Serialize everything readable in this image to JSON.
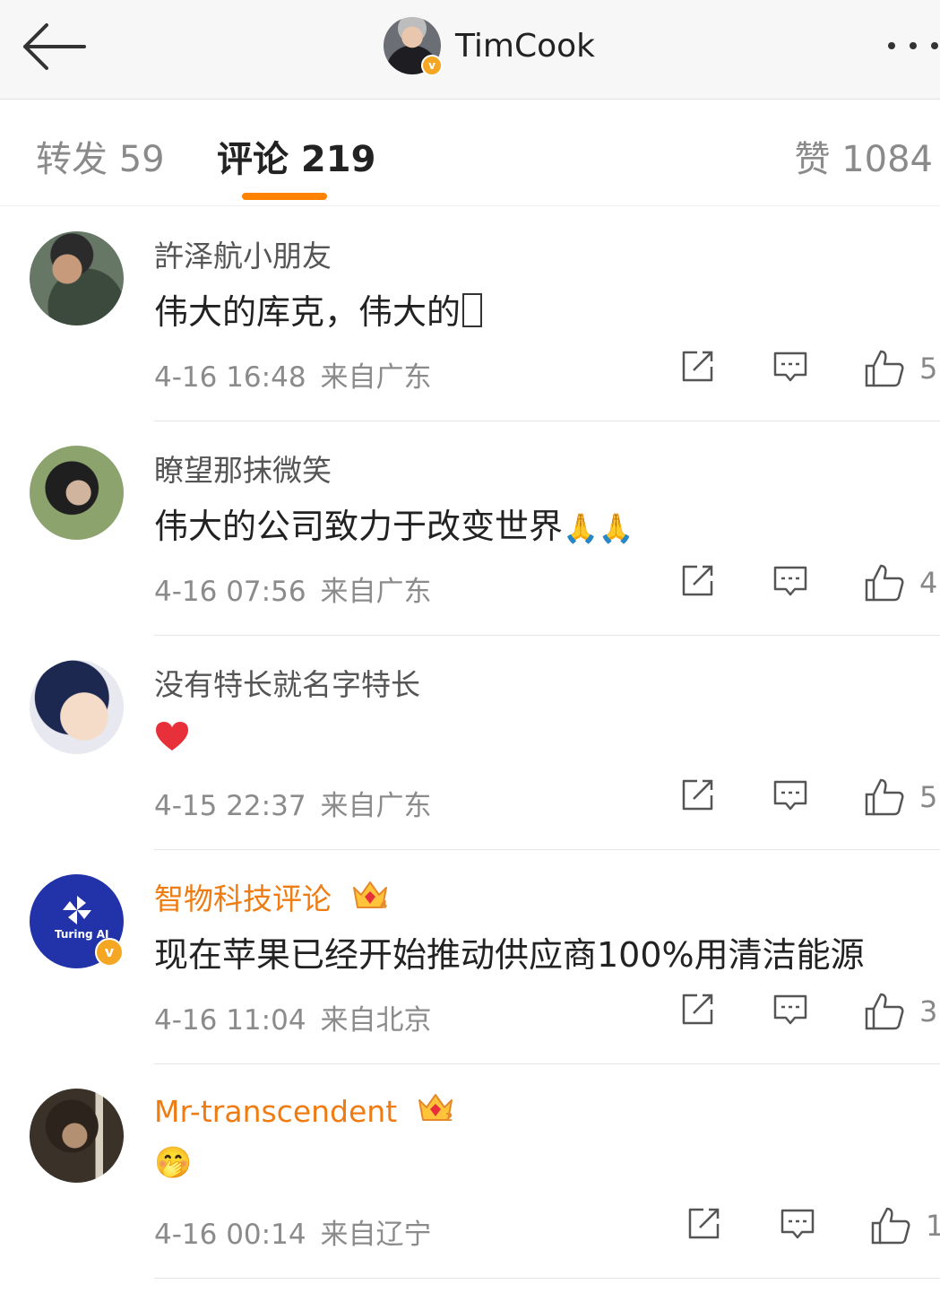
{
  "header": {
    "title": "TimCook",
    "back_icon": "arrow-left-icon",
    "more_icon": "more-dots-icon",
    "badge_color": "#f5a623"
  },
  "tabs": {
    "repost_label": "转发 59",
    "comment_label": "评论 219",
    "like_label": "赞 1084",
    "active": "comment",
    "active_color": "#ff8200"
  },
  "comments": [
    {
      "username": "許泽航小朋友",
      "text": "伟大的库克，伟大的",
      "time": "4-16 16:48",
      "location": "来自广东",
      "likes": "5",
      "vip": false
    },
    {
      "username": "瞭望那抹微笑",
      "text": "伟大的公司致力于改变世界",
      "emoji": "🙏🙏",
      "time": "4-16 07:56",
      "location": "来自广东",
      "likes": "4",
      "vip": false
    },
    {
      "username": "没有特长就名字特长",
      "text": "",
      "emoji": "❤",
      "time": "4-15 22:37",
      "location": "来自广东",
      "likes": "5",
      "vip": false
    },
    {
      "username": "智物科技评论",
      "text": "现在苹果已经开始推动供应商100%用清洁能源",
      "avatar_text": "Turing AI",
      "verified": true,
      "time": "4-16 11:04",
      "location": "来自北京",
      "likes": "3",
      "vip": true,
      "vip_level": "4"
    },
    {
      "username": "Mr-transcendent",
      "text": "",
      "emoji": "🤭",
      "time": "4-16 00:14",
      "location": "来自辽宁",
      "likes": "1",
      "vip": true,
      "vip_level": "2"
    }
  ],
  "icons": {
    "share": "share-icon",
    "reply": "comment-icon",
    "like": "thumbs-up-icon"
  },
  "colors": {
    "vip_name": "#ef7c12",
    "meta_gray": "#8b8b8b",
    "heart": "#e8303a"
  }
}
